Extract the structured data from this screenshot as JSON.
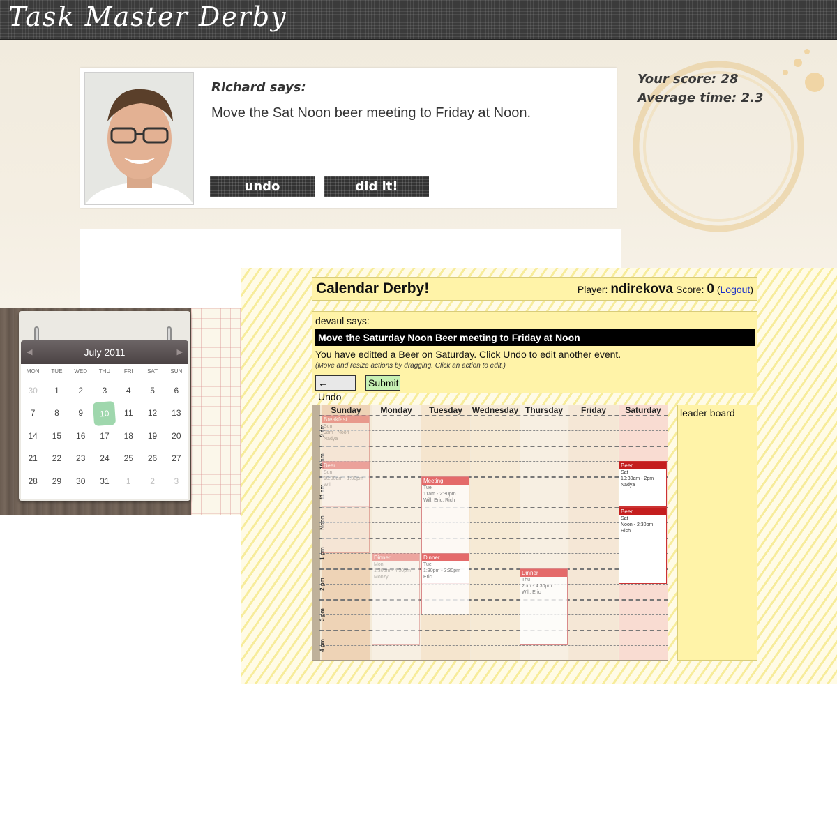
{
  "app": {
    "title": "Task Master Derby"
  },
  "task": {
    "speaker": "Richard says:",
    "message": "Move the Sat Noon beer meeting to Friday at Noon.",
    "undo_label": "undo",
    "didit_label": "did it!"
  },
  "stats": {
    "score": "Your score: 28",
    "avg_time": "Average time: 2.3"
  },
  "mini_calendar": {
    "month": "July 2011",
    "dows": [
      "MON",
      "TUE",
      "WED",
      "THU",
      "FRI",
      "SAT",
      "SUN"
    ],
    "weeks": [
      [
        "30",
        "1",
        "2",
        "3",
        "4",
        "5",
        "6"
      ],
      [
        "7",
        "8",
        "9",
        "10",
        "11",
        "12",
        "13"
      ],
      [
        "14",
        "15",
        "16",
        "17",
        "18",
        "19",
        "20"
      ],
      [
        "21",
        "22",
        "23",
        "24",
        "25",
        "26",
        "27"
      ],
      [
        "28",
        "29",
        "30",
        "31",
        "1",
        "2",
        "3"
      ]
    ],
    "today": "10"
  },
  "derby": {
    "title": "Calendar Derby!",
    "player_label": "Player:",
    "player_name": "ndirekova",
    "score_label": "Score:",
    "score_value": "0",
    "logout": "Logout",
    "speaker": "devaul says:",
    "task": "Move the Saturday Noon Beer meeting to Friday at Noon",
    "status": "You have editted a Beer on Saturday. Click Undo to edit another event.",
    "hint": "(Move and resize actions by dragging. Click an action to edit.)",
    "undo_label": "← Undo",
    "submit_label": "Submit",
    "leaderboard": "leader board",
    "days": [
      "Sunday",
      "Monday",
      "Tuesday",
      "Wednesday",
      "Thursday",
      "Friday",
      "Saturday"
    ],
    "hours": [
      "9 am",
      "10 am",
      "11 am",
      "Noon",
      "1 pm",
      "2 pm",
      "3 pm",
      "4 pm"
    ],
    "events": [
      {
        "title": "Breakfast",
        "body": "Sun\n9am - Noon\nNadya"
      },
      {
        "title": "Beer",
        "body": "Sun\n10:30am - 1:30pm\nWill"
      },
      {
        "title": "Meeting",
        "body": "Tue\n11am - 2:30pm\nWill, Eric, Rich"
      },
      {
        "title": "Dinner",
        "body": "Mon\n1:30pm - 4:30pm\nMonzy"
      },
      {
        "title": "Dinner",
        "body": "Tue\n1:30pm - 3:30pm\nEric"
      },
      {
        "title": "Dinner",
        "body": "Thu\n2pm - 4:30pm\nWill, Eric"
      },
      {
        "title": "Beer",
        "body": "Sat\n10:30am - 2pm\nNadya"
      },
      {
        "title": "Beer",
        "body": "Sat\nNoon - 2:30pm\nRich"
      }
    ]
  },
  "colors": {
    "event_header": "#e46a6a",
    "event_active": "#c41e1e",
    "panel_yellow": "#fff3a8",
    "submit_green": "#c6f0b4"
  }
}
